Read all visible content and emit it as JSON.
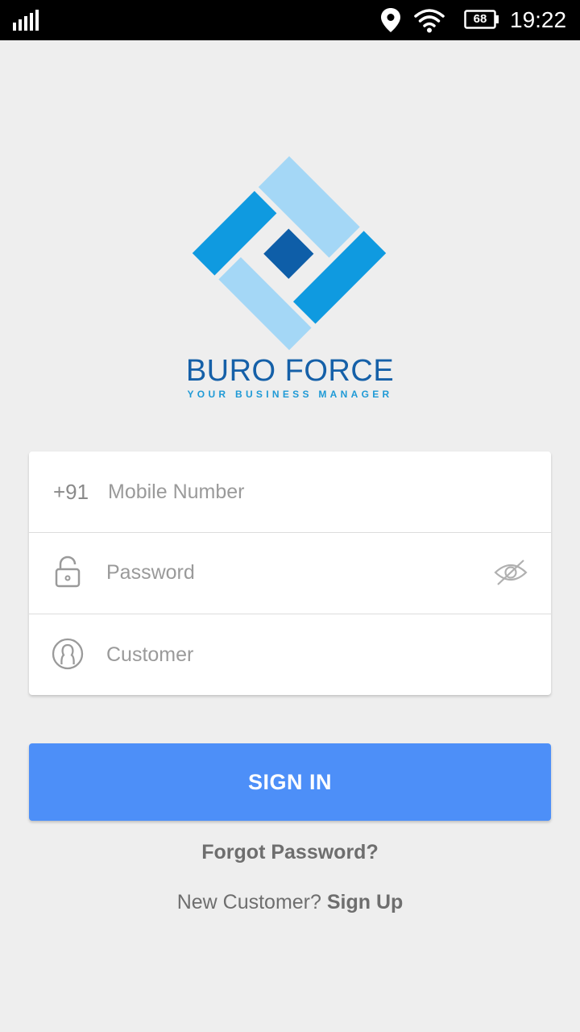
{
  "status_bar": {
    "battery_level": "68",
    "time": "19:22",
    "icons": [
      "signal-icon",
      "location-icon",
      "wifi-icon",
      "battery-icon"
    ]
  },
  "brand": {
    "name": "BURO FORCE",
    "tagline": "YOUR BUSINESS MANAGER",
    "colors": {
      "light": "#a4d7f6",
      "mid": "#0f9ae0",
      "dark": "#0e5ea8"
    }
  },
  "form": {
    "mobile": {
      "country_code": "+91",
      "placeholder": "Mobile Number",
      "value": ""
    },
    "password": {
      "placeholder": "Password",
      "value": ""
    },
    "customer": {
      "placeholder": "Customer",
      "value": ""
    }
  },
  "actions": {
    "sign_in_label": "SIGN IN",
    "forgot_password": "Forgot Password?",
    "new_customer_prompt": "New Customer?",
    "sign_up_label": "Sign Up"
  },
  "colors": {
    "background": "#eeeeee",
    "primary_button": "#4d8ff8",
    "muted_text": "#6e6e6e"
  }
}
